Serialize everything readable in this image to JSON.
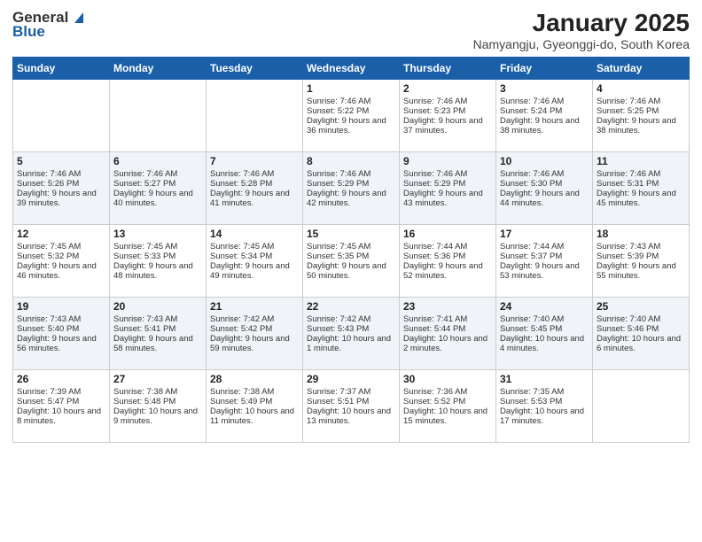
{
  "header": {
    "logo_general": "General",
    "logo_blue": "Blue",
    "title": "January 2025",
    "location": "Namyangju, Gyeonggi-do, South Korea"
  },
  "days_of_week": [
    "Sunday",
    "Monday",
    "Tuesday",
    "Wednesday",
    "Thursday",
    "Friday",
    "Saturday"
  ],
  "weeks": [
    [
      {
        "day": "",
        "content": ""
      },
      {
        "day": "",
        "content": ""
      },
      {
        "day": "",
        "content": ""
      },
      {
        "day": "1",
        "content": "Sunrise: 7:46 AM\nSunset: 5:22 PM\nDaylight: 9 hours and 36 minutes."
      },
      {
        "day": "2",
        "content": "Sunrise: 7:46 AM\nSunset: 5:23 PM\nDaylight: 9 hours and 37 minutes."
      },
      {
        "day": "3",
        "content": "Sunrise: 7:46 AM\nSunset: 5:24 PM\nDaylight: 9 hours and 38 minutes."
      },
      {
        "day": "4",
        "content": "Sunrise: 7:46 AM\nSunset: 5:25 PM\nDaylight: 9 hours and 38 minutes."
      }
    ],
    [
      {
        "day": "5",
        "content": "Sunrise: 7:46 AM\nSunset: 5:26 PM\nDaylight: 9 hours and 39 minutes."
      },
      {
        "day": "6",
        "content": "Sunrise: 7:46 AM\nSunset: 5:27 PM\nDaylight: 9 hours and 40 minutes."
      },
      {
        "day": "7",
        "content": "Sunrise: 7:46 AM\nSunset: 5:28 PM\nDaylight: 9 hours and 41 minutes."
      },
      {
        "day": "8",
        "content": "Sunrise: 7:46 AM\nSunset: 5:29 PM\nDaylight: 9 hours and 42 minutes."
      },
      {
        "day": "9",
        "content": "Sunrise: 7:46 AM\nSunset: 5:29 PM\nDaylight: 9 hours and 43 minutes."
      },
      {
        "day": "10",
        "content": "Sunrise: 7:46 AM\nSunset: 5:30 PM\nDaylight: 9 hours and 44 minutes."
      },
      {
        "day": "11",
        "content": "Sunrise: 7:46 AM\nSunset: 5:31 PM\nDaylight: 9 hours and 45 minutes."
      }
    ],
    [
      {
        "day": "12",
        "content": "Sunrise: 7:45 AM\nSunset: 5:32 PM\nDaylight: 9 hours and 46 minutes."
      },
      {
        "day": "13",
        "content": "Sunrise: 7:45 AM\nSunset: 5:33 PM\nDaylight: 9 hours and 48 minutes."
      },
      {
        "day": "14",
        "content": "Sunrise: 7:45 AM\nSunset: 5:34 PM\nDaylight: 9 hours and 49 minutes."
      },
      {
        "day": "15",
        "content": "Sunrise: 7:45 AM\nSunset: 5:35 PM\nDaylight: 9 hours and 50 minutes."
      },
      {
        "day": "16",
        "content": "Sunrise: 7:44 AM\nSunset: 5:36 PM\nDaylight: 9 hours and 52 minutes."
      },
      {
        "day": "17",
        "content": "Sunrise: 7:44 AM\nSunset: 5:37 PM\nDaylight: 9 hours and 53 minutes."
      },
      {
        "day": "18",
        "content": "Sunrise: 7:43 AM\nSunset: 5:39 PM\nDaylight: 9 hours and 55 minutes."
      }
    ],
    [
      {
        "day": "19",
        "content": "Sunrise: 7:43 AM\nSunset: 5:40 PM\nDaylight: 9 hours and 56 minutes."
      },
      {
        "day": "20",
        "content": "Sunrise: 7:43 AM\nSunset: 5:41 PM\nDaylight: 9 hours and 58 minutes."
      },
      {
        "day": "21",
        "content": "Sunrise: 7:42 AM\nSunset: 5:42 PM\nDaylight: 9 hours and 59 minutes."
      },
      {
        "day": "22",
        "content": "Sunrise: 7:42 AM\nSunset: 5:43 PM\nDaylight: 10 hours and 1 minute."
      },
      {
        "day": "23",
        "content": "Sunrise: 7:41 AM\nSunset: 5:44 PM\nDaylight: 10 hours and 2 minutes."
      },
      {
        "day": "24",
        "content": "Sunrise: 7:40 AM\nSunset: 5:45 PM\nDaylight: 10 hours and 4 minutes."
      },
      {
        "day": "25",
        "content": "Sunrise: 7:40 AM\nSunset: 5:46 PM\nDaylight: 10 hours and 6 minutes."
      }
    ],
    [
      {
        "day": "26",
        "content": "Sunrise: 7:39 AM\nSunset: 5:47 PM\nDaylight: 10 hours and 8 minutes."
      },
      {
        "day": "27",
        "content": "Sunrise: 7:38 AM\nSunset: 5:48 PM\nDaylight: 10 hours and 9 minutes."
      },
      {
        "day": "28",
        "content": "Sunrise: 7:38 AM\nSunset: 5:49 PM\nDaylight: 10 hours and 11 minutes."
      },
      {
        "day": "29",
        "content": "Sunrise: 7:37 AM\nSunset: 5:51 PM\nDaylight: 10 hours and 13 minutes."
      },
      {
        "day": "30",
        "content": "Sunrise: 7:36 AM\nSunset: 5:52 PM\nDaylight: 10 hours and 15 minutes."
      },
      {
        "day": "31",
        "content": "Sunrise: 7:35 AM\nSunset: 5:53 PM\nDaylight: 10 hours and 17 minutes."
      },
      {
        "day": "",
        "content": ""
      }
    ]
  ]
}
